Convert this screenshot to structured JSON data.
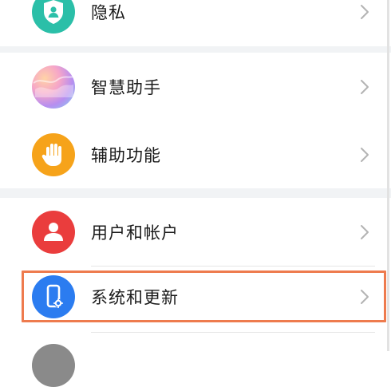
{
  "settings": {
    "items": [
      {
        "label": "隐私",
        "icon": "privacy-shield-icon",
        "color": "#2bbfa8"
      },
      {
        "label": "智慧助手",
        "icon": "smart-assistant-icon",
        "color": "#b88ee6"
      },
      {
        "label": "辅助功能",
        "icon": "accessibility-hand-icon",
        "color": "#f6a31a"
      },
      {
        "label": "用户和帐户",
        "icon": "user-account-icon",
        "color": "#ea3d3d"
      },
      {
        "label": "系统和更新",
        "icon": "system-update-icon",
        "color": "#2b7cf0"
      }
    ],
    "highlight_color": "#ee7b4e",
    "next_item_icon_color": "#8a8a8a"
  }
}
